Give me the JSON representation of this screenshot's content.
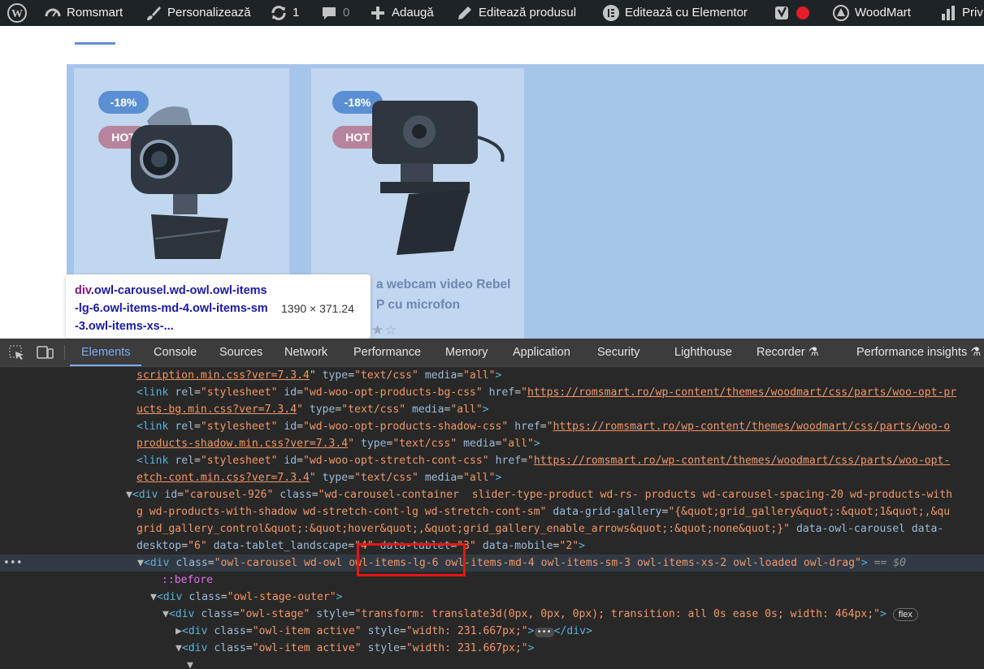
{
  "adminbar": {
    "site": "Romsmart",
    "customize": "Personalizează",
    "updates_count": "1",
    "comments_count": "0",
    "add_new": "Adaugă",
    "edit_product": "Editează produsul",
    "edit_elementor": "Editează cu Elementor",
    "theme": "WoodMart",
    "privacy_partial": "Priv"
  },
  "products": [
    {
      "sale_badge": "-18%",
      "hot_badge": "HOT"
    },
    {
      "sale_badge": "-18%",
      "hot_badge": "HOT",
      "title_lines": [
        "a webcam video Rebel",
        "P cu microfon"
      ]
    }
  ],
  "tooltip": {
    "tag": "div",
    "classes": ".owl-carousel.wd-owl.owl-items-lg-6.owl-items-md-4.owl-items-sm-3.owl-items-xs-...",
    "dimensions": "1390 × 371.24"
  },
  "devtools": {
    "tabs": [
      "Elements",
      "Console",
      "Sources",
      "Network",
      "Performance",
      "Memory",
      "Application",
      "Security",
      "Lighthouse",
      "Recorder",
      "Performance insights"
    ],
    "active_tab": "Elements",
    "code": {
      "l0": "scription.min.css?ver=7.3.4",
      "l1_id": "wd-woo-opt-products-bg-css",
      "l1_href": "https://romsmart.ro/wp-content/themes/woodmart/css/parts/woo-opt-pr",
      "l2": "ucts-bg.min.css?ver=7.3.4",
      "l3_id": "wd-woo-opt-products-shadow-css",
      "l3_href": "https://romsmart.ro/wp-content/themes/woodmart/css/parts/woo-o",
      "l4": "products-shadow.min.css?ver=7.3.4",
      "l5_id": "wd-woo-opt-stretch-cont-css",
      "l5_href": "https://romsmart.ro/wp-content/themes/woodmart/css/parts/woo-opt-",
      "l6": "etch-cont.min.css?ver=7.3.4",
      "l7_id": "carousel-926",
      "l7_class": "wd-carousel-container  slider-type-product wd-rs- products wd-carousel-spacing-20 wd-products-with",
      "l8": "g wd-products-with-shadow wd-stretch-cont-lg wd-stretch-cont-sm",
      "l8_attr": "data-grid-gallery",
      "l8_val": "{&quot;grid_gallery&quot;:&quot;1&quot;,&qu",
      "l9_val": "grid_gallery_control&quot;:&quot;hover&quot;,&quot;grid_gallery_enable_arrows&quot;:&quot;none&quot;}",
      "l9_attr": "data-owl-carousel data-",
      "l10_a": "desktop",
      "l10_v1": "6",
      "l10_b": "data-tablet_landscape",
      "l10_v2": "4",
      "l10_c": "data-tablet",
      "l10_v3": "3",
      "l10_d": "data-mobile",
      "l10_v4": "2",
      "l11_class": "owl-carousel wd-owl owl-items-lg-6 owl-items-md-4 owl-items-sm-3 owl-items-xs-2 owl-loaded owl-drag",
      "l11_ref": "== $0",
      "l12": "::before",
      "l13_class": "owl-stage-outer",
      "l14_class": "owl-stage",
      "l14_style": "transform: translate3d(0px, 0px, 0px); transition: all 0s ease 0s; width: 464px;",
      "l14_badge": "flex",
      "l15_class": "owl-item active",
      "l15_style": "width: 231.667px;",
      "l16_class": "owl-item active",
      "l16_style": "width: 231.667px;"
    }
  }
}
